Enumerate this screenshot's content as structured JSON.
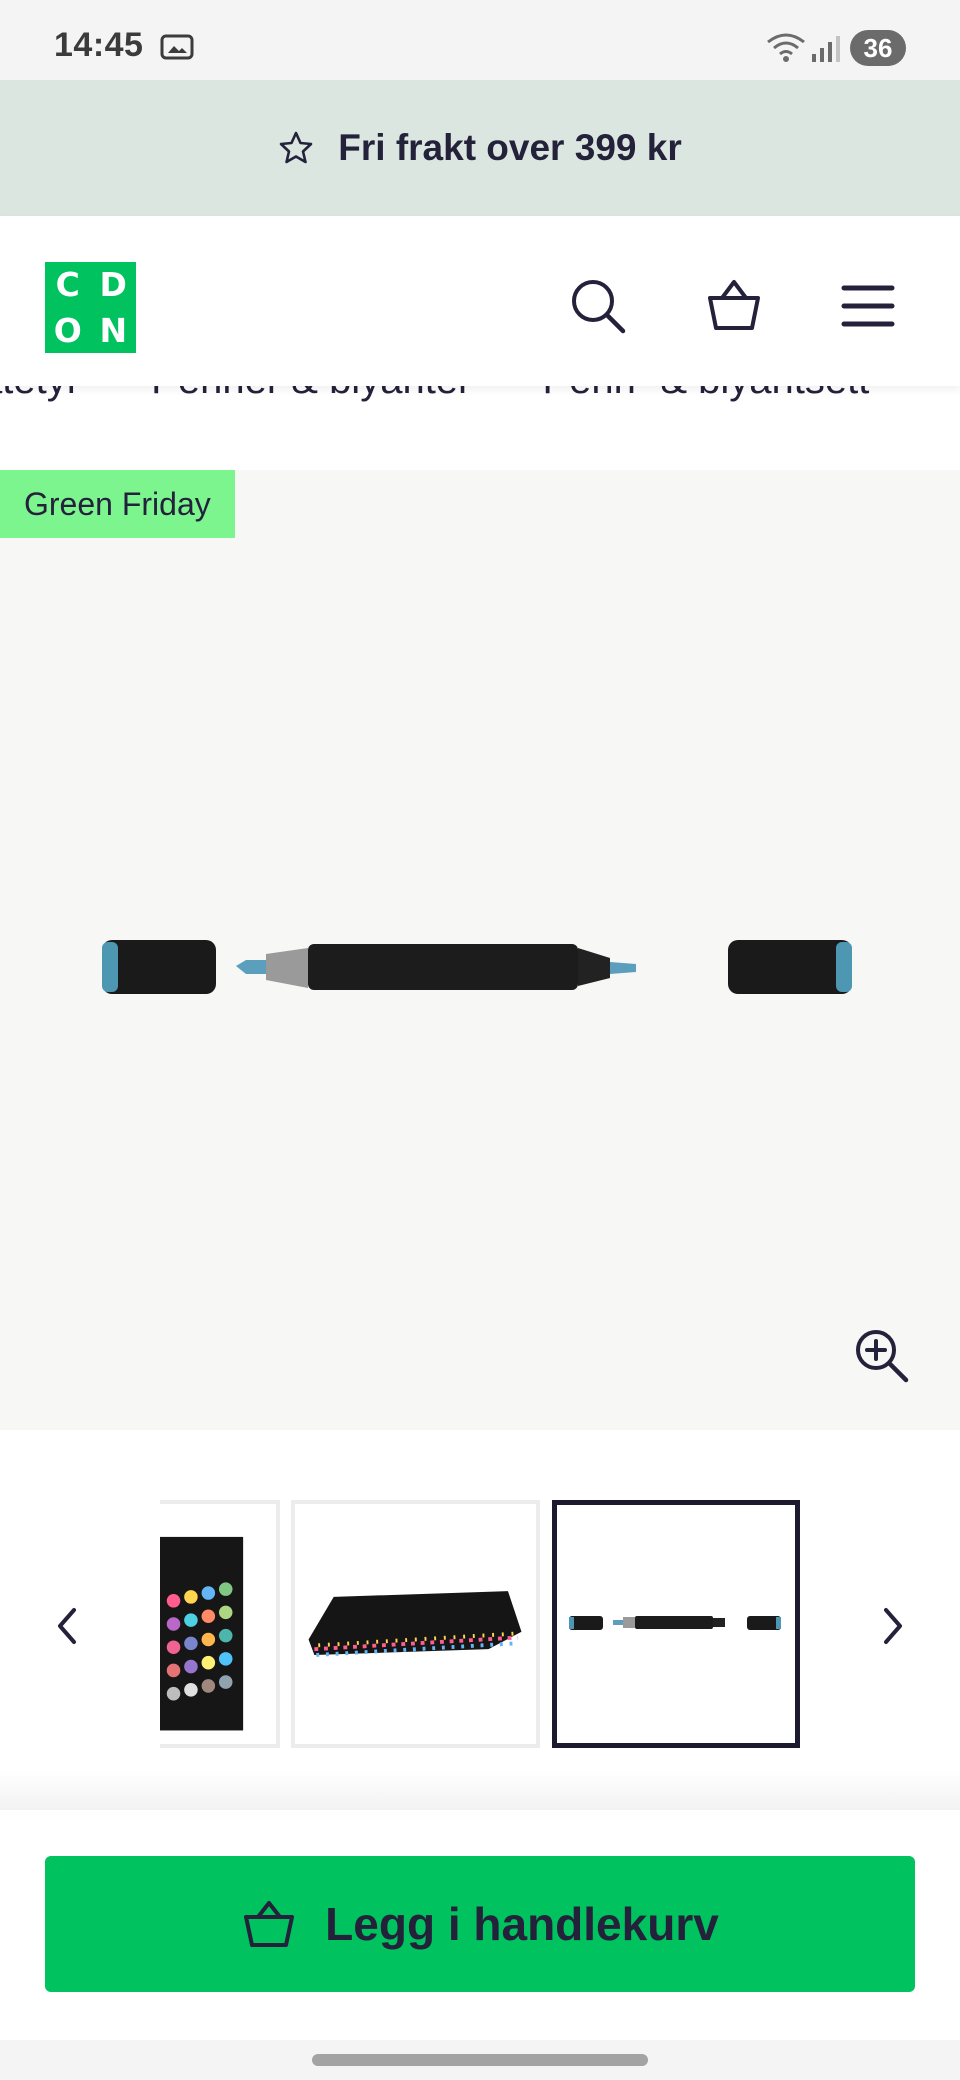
{
  "status_bar": {
    "time": "14:45",
    "battery": "36"
  },
  "promo": {
    "text": "Fri frakt over 399 kr"
  },
  "header": {
    "logo_letters": [
      "C",
      "D",
      "O",
      "N"
    ]
  },
  "breadcrumb": {
    "items": [
      "katetyr",
      "Penner & blyanter",
      "Penn- & blyantsett"
    ]
  },
  "product": {
    "badge": "Green Friday",
    "selected_thumbnail_index": 3,
    "thumbnail_count_visible": 3
  },
  "cart": {
    "button_label": "Legg i handlekurv"
  },
  "colors": {
    "brand_green": "#00c25e",
    "badge_green": "#7df58f",
    "promo_background": "#dce6e0",
    "text_dark": "#24213a"
  },
  "icons": [
    "photo-icon",
    "wifi-icon",
    "signal-icon",
    "star-icon",
    "search-icon",
    "basket-icon",
    "menu-icon",
    "zoom-in-icon",
    "chevron-left-icon",
    "chevron-right-icon",
    "cart-icon"
  ]
}
